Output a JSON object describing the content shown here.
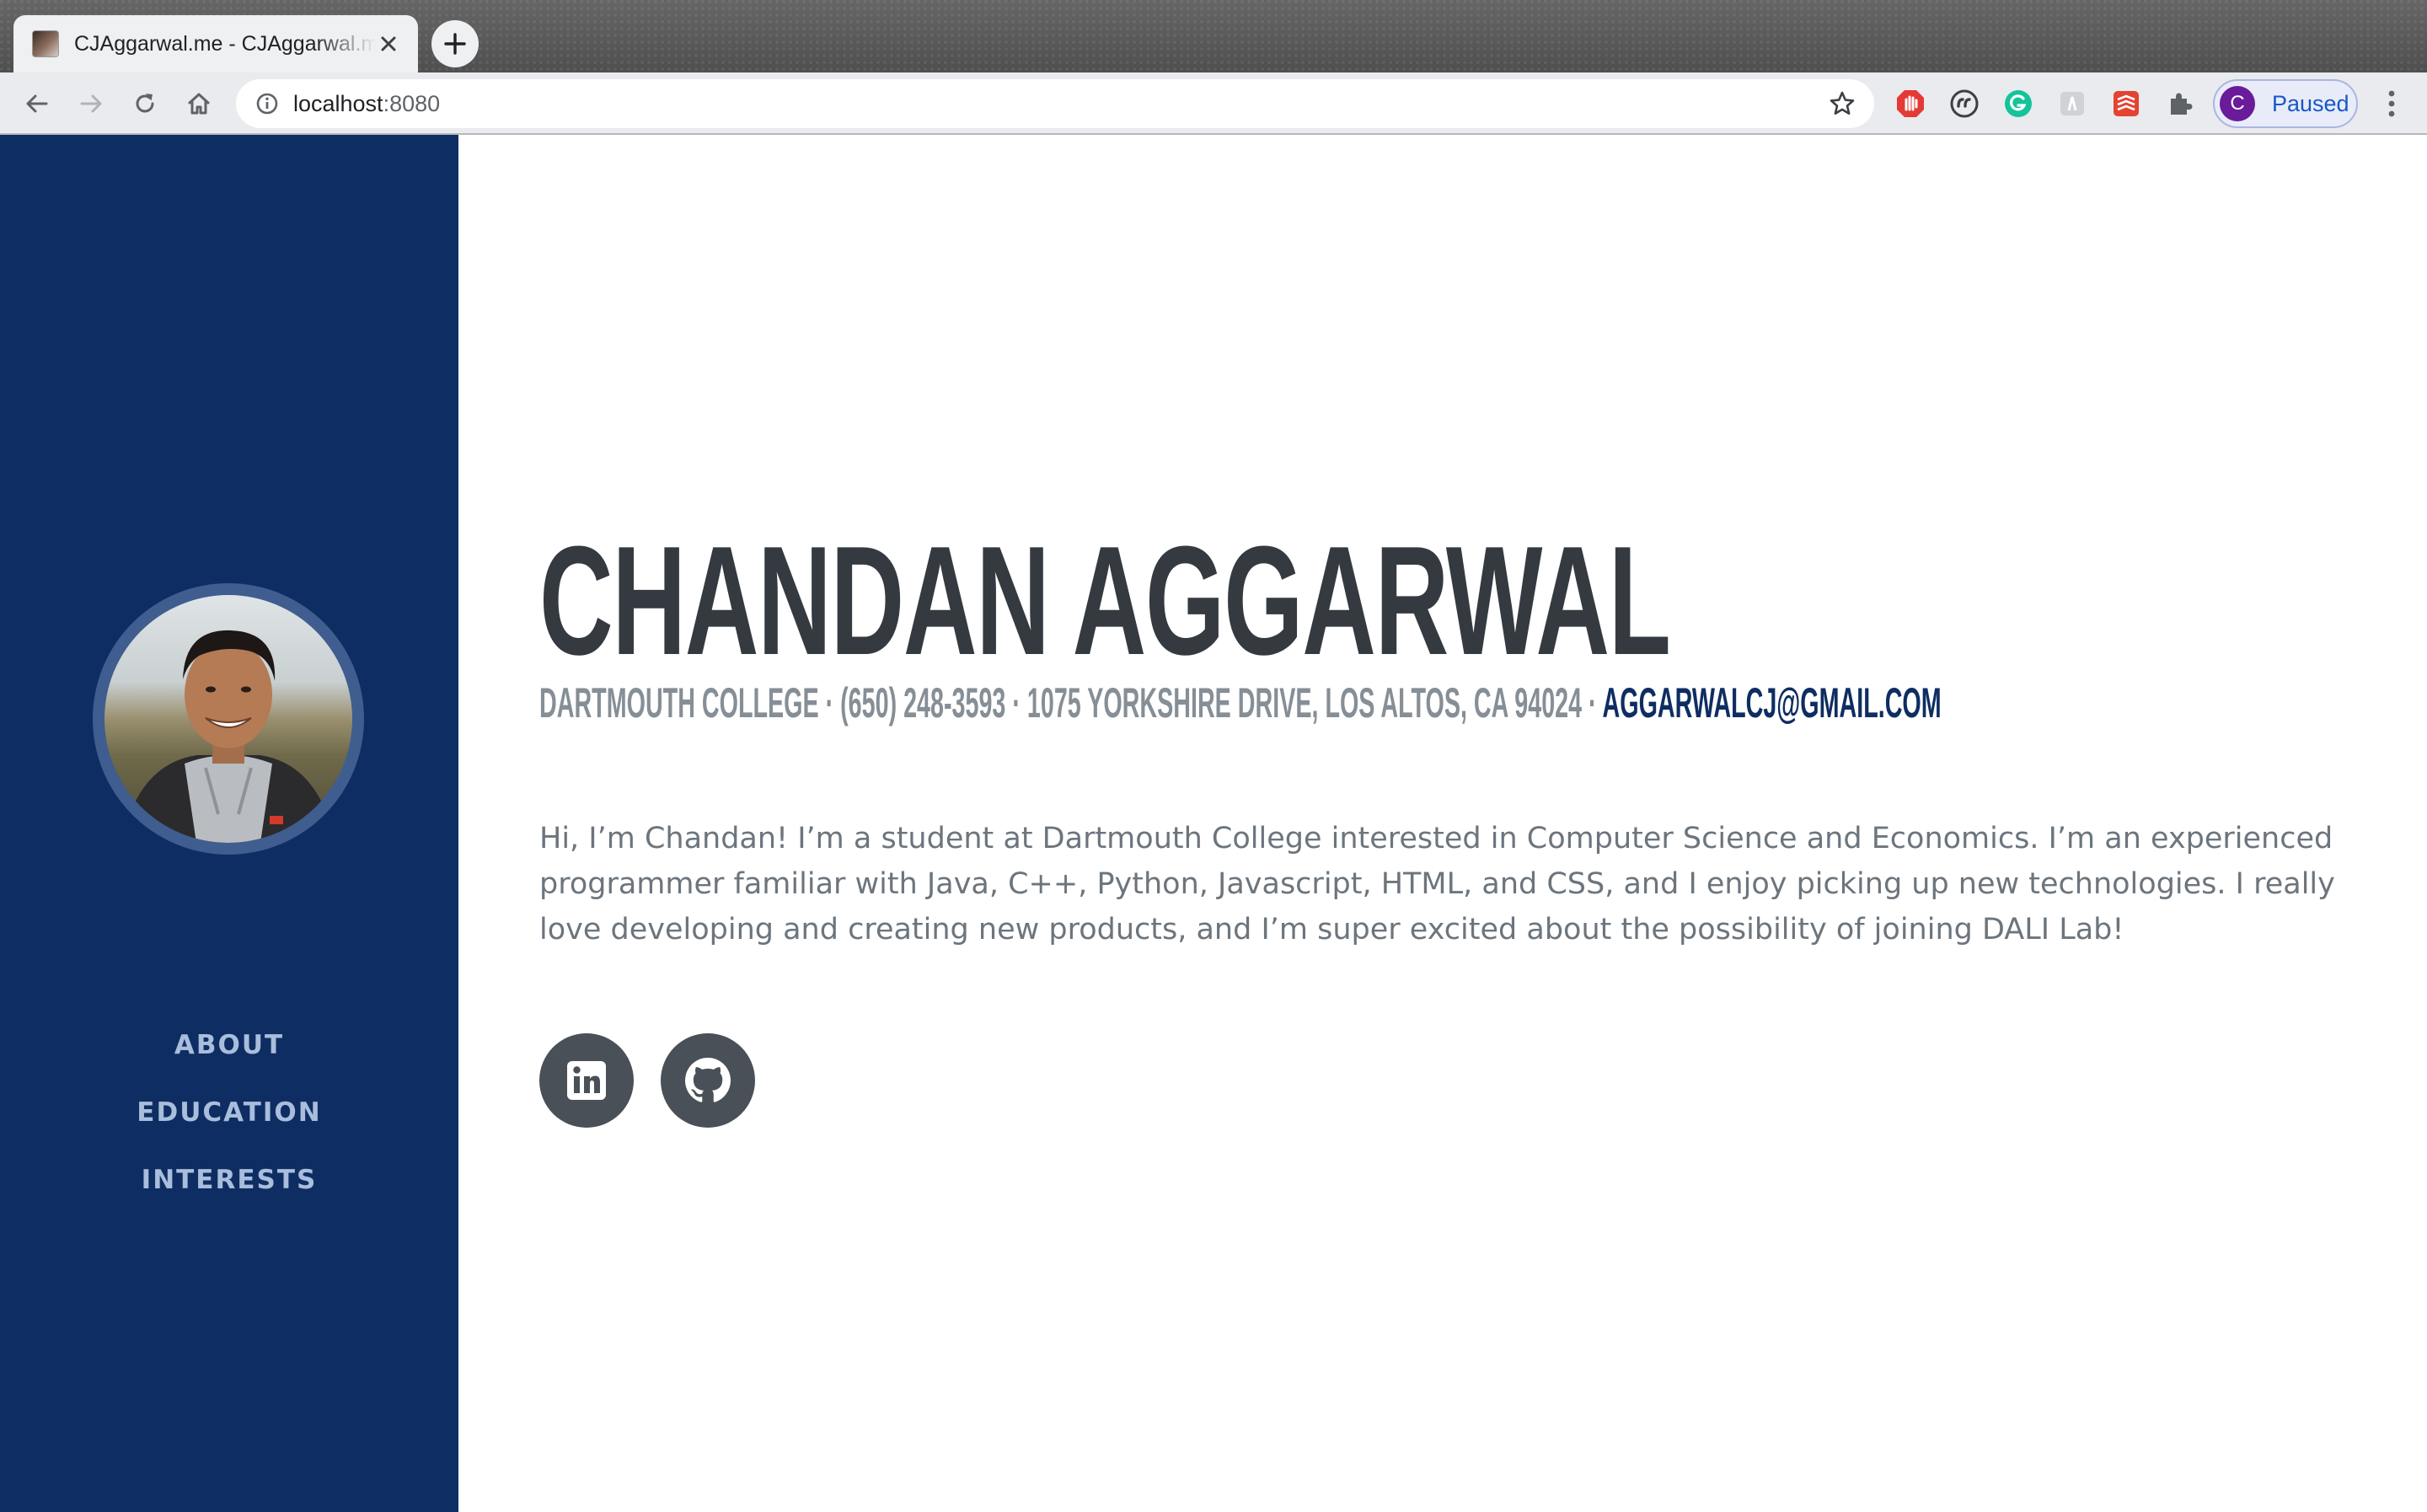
{
  "browser": {
    "tab_title": "CJAggarwal.me - CJAggarwal.me",
    "url_host": "localhost",
    "url_port": ":8080",
    "profile_initial": "C",
    "profile_status": "Paused"
  },
  "sidebar": {
    "nav": [
      {
        "label": "ABOUT"
      },
      {
        "label": "EDUCATION"
      },
      {
        "label": "INTERESTS"
      }
    ]
  },
  "main": {
    "name": "CHANDAN AGGARWAL",
    "subheading_text": "DARTMOUTH COLLEGE · (650) 248-3593 · 1075 YORKSHIRE DRIVE, LOS ALTOS, CA 94024 · ",
    "email": "AGGARWALCJ@GMAIL.COM",
    "bio": "Hi, I’m Chandan! I’m a student at Dartmouth College interested in Computer Science and Economics. I’m an experienced programmer familiar with Java, C++, Python, Javascript, HTML, and CSS, and I enjoy picking up new technologies. I really love developing and creating new products, and I’m super excited about the possibility of joining DALI Lab!",
    "social": [
      {
        "icon": "linkedin-icon"
      },
      {
        "icon": "github-icon"
      }
    ]
  },
  "colors": {
    "sidebar_bg": "#0e2d62",
    "heading": "#343a40",
    "subheading": "#868e96",
    "accent": "#0e2d62",
    "body_text": "#6c757d",
    "social_bg": "#495057"
  }
}
